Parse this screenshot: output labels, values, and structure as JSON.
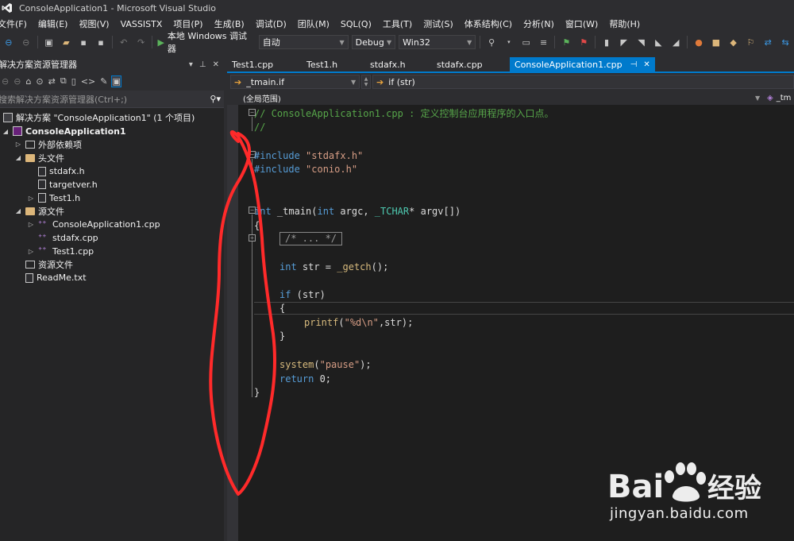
{
  "window": {
    "title": "ConsoleApplication1 - Microsoft Visual Studio"
  },
  "menu": [
    "文件(F)",
    "编辑(E)",
    "视图(V)",
    "VASSISTX",
    "项目(P)",
    "生成(B)",
    "调试(D)",
    "团队(M)",
    "SQL(Q)",
    "工具(T)",
    "测试(S)",
    "体系结构(C)",
    "分析(N)",
    "窗口(W)",
    "帮助(H)"
  ],
  "toolbar": {
    "run_label": "本地 Windows 调试器",
    "run_mode": "自动",
    "configuration": "Debug",
    "platform": "Win32"
  },
  "solution_explorer": {
    "title": "解决方案资源管理器",
    "search_placeholder": "搜索解决方案资源管理器(Ctrl+;)",
    "tree": [
      {
        "label": "解决方案 \"ConsoleApplication1\" (1 个项目)",
        "kind": "solution",
        "indent": 0,
        "twisty": ""
      },
      {
        "label": "ConsoleApplication1",
        "kind": "project",
        "indent": 0,
        "twisty": "expanded"
      },
      {
        "label": "外部依赖项",
        "kind": "folder-dark",
        "indent": 1,
        "twisty": "collapsed"
      },
      {
        "label": "头文件",
        "kind": "folder",
        "indent": 1,
        "twisty": "expanded"
      },
      {
        "label": "stdafx.h",
        "kind": "file",
        "indent": 2,
        "twisty": ""
      },
      {
        "label": "targetver.h",
        "kind": "file",
        "indent": 2,
        "twisty": ""
      },
      {
        "label": "Test1.h",
        "kind": "file",
        "indent": 2,
        "twisty": "collapsed"
      },
      {
        "label": "源文件",
        "kind": "folder",
        "indent": 1,
        "twisty": "expanded"
      },
      {
        "label": "ConsoleApplication1.cpp",
        "kind": "cpp",
        "indent": 2,
        "twisty": "collapsed"
      },
      {
        "label": "stdafx.cpp",
        "kind": "cpp",
        "indent": 2,
        "twisty": ""
      },
      {
        "label": "Test1.cpp",
        "kind": "cpp",
        "indent": 2,
        "twisty": "collapsed"
      },
      {
        "label": "资源文件",
        "kind": "folder-dark",
        "indent": 1,
        "twisty": ""
      },
      {
        "label": "ReadMe.txt",
        "kind": "file",
        "indent": 1,
        "twisty": ""
      }
    ]
  },
  "tabs": [
    "Test1.cpp",
    "Test1.h",
    "stdafx.h",
    "stdafx.cpp",
    "ConsoleApplication1.cpp"
  ],
  "active_tab": "ConsoleApplication1.cpp",
  "navbar": {
    "left": "_tmain.if",
    "right": "if (str)"
  },
  "scope": {
    "label": "(全局范围)",
    "right": "_tm"
  },
  "code": {
    "line1": "// ConsoleApplication1.cpp : 定义控制台应用程序的入口点。",
    "line2": "//",
    "inc1_kw": "#include",
    "inc1_str": "\"stdafx.h\"",
    "inc2_kw": "#include",
    "inc2_str": "\"conio.h\"",
    "main_kw": "int",
    "main_name": "_tmain",
    "main_args_open": "(",
    "main_arg1_type": "int",
    "main_arg1": " argc, ",
    "main_arg2_type": "_TCHAR",
    "main_arg2": "* argv[])",
    "brace_open": "{",
    "collapsed": "/* ... */",
    "decl_kw": "int",
    "decl_rest": " str = ",
    "decl_fn": "_getch",
    "decl_end": "();",
    "if_kw": "if",
    "if_rest": " (str)",
    "if_open": "{",
    "printf_fn": "printf",
    "printf_open": "(",
    "printf_str": "\"%d\\n\"",
    "printf_rest": ",str);",
    "if_close": "}",
    "sys_fn": "system",
    "sys_open": "(",
    "sys_str": "\"pause\"",
    "sys_end": ");",
    "ret_kw": "return",
    "ret_rest": " 0;",
    "brace_close": "}"
  },
  "watermark": {
    "text": "jingyan.baidu.com"
  },
  "colors": {
    "accent": "#007acc",
    "comment": "#57a64a",
    "keyword": "#569cd6",
    "string": "#d69d85",
    "annotation": "#ff2a2a"
  }
}
